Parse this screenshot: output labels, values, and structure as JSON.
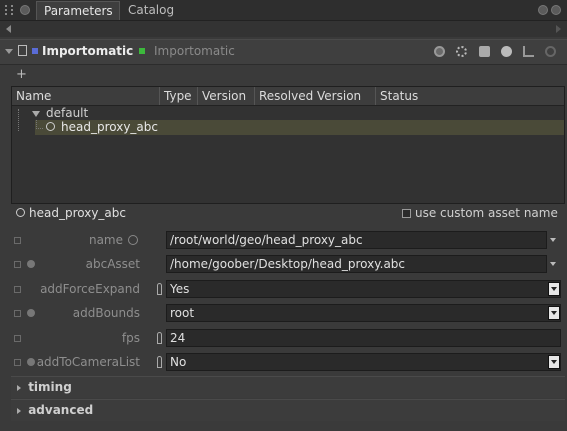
{
  "tabs": [
    "Parameters",
    "Catalog"
  ],
  "header": {
    "node_name": "Importomatic",
    "node_type": "Importomatic"
  },
  "toolbar": {
    "add_label": "+"
  },
  "tree": {
    "columns": [
      "Name",
      "Type",
      "Version",
      "Resolved Version",
      "Status"
    ],
    "rows": [
      {
        "label": "default"
      },
      {
        "label": "head_proxy_abc"
      }
    ]
  },
  "selected": {
    "title": "head_proxy_abc",
    "use_custom_label": "use custom asset name"
  },
  "params": [
    {
      "label": "name",
      "value": "/root/world/geo/head_proxy_abc"
    },
    {
      "label": "abcAsset",
      "value": "/home/goober/Desktop/head_proxy.abc"
    },
    {
      "label": "addForceExpand",
      "value": "Yes"
    },
    {
      "label": "addBounds",
      "value": "root"
    },
    {
      "label": "fps",
      "value": "24"
    },
    {
      "label": "addToCameraList",
      "value": "No"
    }
  ],
  "sections": [
    "timing",
    "advanced"
  ],
  "colors": {
    "accent_blue": "#5a6cd6",
    "accent_green": "#3cb83c",
    "selected_row": "#4a4a38"
  },
  "icons": [
    "pin-icon",
    "close-icon",
    "add-icon",
    "bookmark-icon",
    "collapse-arrow-icon",
    "asset-icon",
    "key-icon",
    "dropdown-arrow-icon",
    "expression-icon"
  ]
}
